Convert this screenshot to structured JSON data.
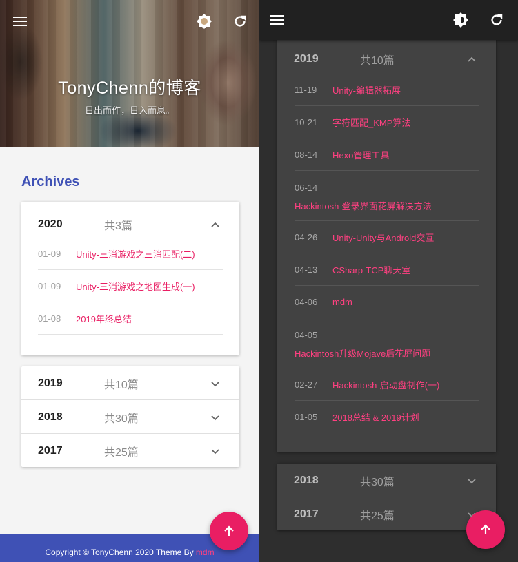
{
  "light": {
    "blog_title": "TonyChenn的博客",
    "blog_subtitle": "日出而作，日入而息。",
    "archives_heading": "Archives",
    "expanded": {
      "year": "2020",
      "count": "共3篇",
      "posts": [
        {
          "date": "01-09",
          "title": "Unity-三消游戏之三消匹配(二)"
        },
        {
          "date": "01-09",
          "title": "Unity-三消游戏之地图生成(一)"
        },
        {
          "date": "01-08",
          "title": "2019年终总结"
        }
      ]
    },
    "collapsed": [
      {
        "year": "2019",
        "count": "共10篇"
      },
      {
        "year": "2018",
        "count": "共30篇"
      },
      {
        "year": "2017",
        "count": "共25篇"
      }
    ],
    "footer": {
      "text": "Copyright © TonyChenn  2020  Theme By ",
      "link": "mdm"
    }
  },
  "dark": {
    "expanded": {
      "year": "2019",
      "count": "共10篇",
      "posts": [
        {
          "date": "11-19",
          "title": "Unity-编辑器拓展"
        },
        {
          "date": "10-21",
          "title": "字符匹配_KMP算法"
        },
        {
          "date": "08-14",
          "title": "Hexo管理工具"
        },
        {
          "date": "06-14",
          "title": "Hackintosh-登录界面花屏解决方法"
        },
        {
          "date": "04-26",
          "title": "Unity-Unity与Android交互"
        },
        {
          "date": "04-13",
          "title": "CSharp-TCP聊天室"
        },
        {
          "date": "04-06",
          "title": "mdm"
        },
        {
          "date": "04-05",
          "title": "Hackintosh升级Mojave后花屏问题"
        },
        {
          "date": "02-27",
          "title": "Hackintosh-启动盘制作(一)"
        },
        {
          "date": "01-05",
          "title": "2018总结 & 2019计划"
        }
      ]
    },
    "collapsed": [
      {
        "year": "2018",
        "count": "共30篇"
      },
      {
        "year": "2017",
        "count": "共25篇"
      }
    ]
  },
  "colors": {
    "primary": "#3f51b5",
    "accent": "#e91e63",
    "dark_bg": "#2e2e2e",
    "dark_card": "#424242"
  },
  "icons": [
    "menu-icon",
    "brightness-icon",
    "refresh-icon",
    "chevron-up-icon",
    "chevron-down-icon",
    "arrow-up-icon"
  ]
}
